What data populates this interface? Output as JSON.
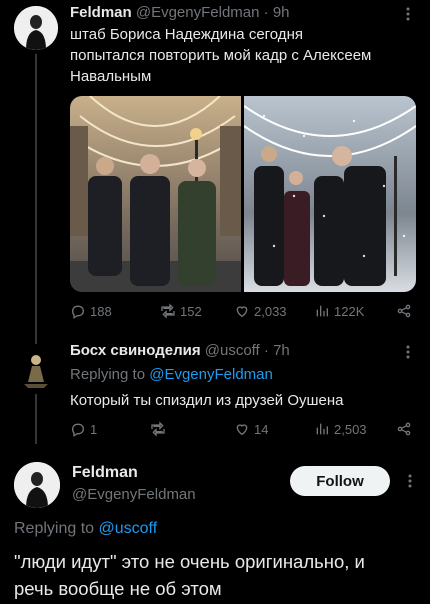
{
  "tweet1": {
    "author_name": "Feldman",
    "handle": "@EvgenyFeldman",
    "separator": "·",
    "time": "9h",
    "text_line1": "штаб Бориса Надеждина сегодня",
    "text_line2": "попытался повторить мой кадр с Алексеем",
    "text_line3": "Навальным",
    "stats": {
      "replies": "188",
      "retweets": "152",
      "likes": "2,033",
      "views": "122K"
    }
  },
  "tweet2": {
    "author_name": "Босх свиноделия",
    "handle": "@uscoff",
    "separator": "·",
    "time": "7h",
    "replying_prefix": "Replying to",
    "replying_handle": "@EvgenyFeldman",
    "text": "Который ты спиздил из друзей Оушена",
    "stats": {
      "replies": "1",
      "retweets": "",
      "likes": "14",
      "views": "2,503"
    }
  },
  "main_tweet": {
    "author_name": "Feldman",
    "handle": "@EvgenyFeldman",
    "follow_label": "Follow",
    "replying_prefix": "Replying to",
    "replying_handle": "@uscoff",
    "text_line1": "\"люди идут\" это не очень оригинально, и",
    "text_line2": "речь вообще не об этом"
  },
  "icons": {
    "reply": "reply-icon",
    "retweet": "retweet-icon",
    "like": "heart-icon",
    "views": "views-icon",
    "share": "share-icon",
    "more": "more-icon"
  },
  "colors": {
    "background": "#000000",
    "text": "#e7e9ea",
    "muted": "#71767b",
    "link": "#1d9bf0"
  }
}
